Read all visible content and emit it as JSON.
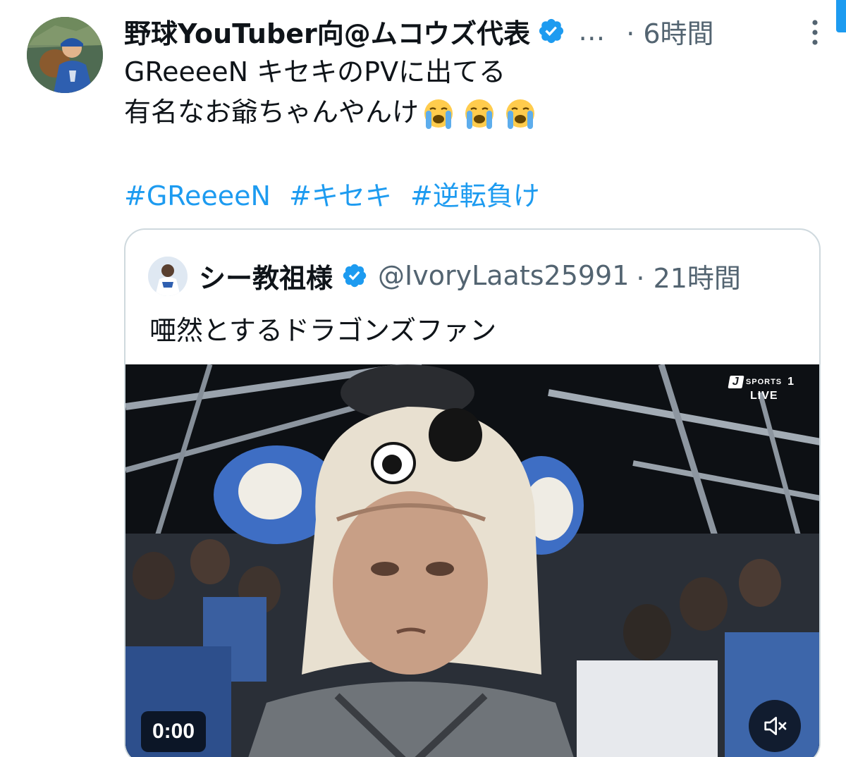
{
  "tweet": {
    "display_name": "野球YouTuber向@ムコウズ代表",
    "truncation": "…",
    "time": "· 6時間",
    "text_lines": [
      "GReeeeN キセキのPVに出てる",
      "有名なお爺ちゃんやんけ"
    ],
    "emoji": [
      "loudly-crying-face",
      "loudly-crying-face",
      "loudly-crying-face"
    ],
    "hashtags": [
      "#GReeeeN",
      "#キセキ",
      "#逆転負け"
    ]
  },
  "quoted": {
    "display_name": "シー教祖様",
    "handle": "@IvoryLaats25991",
    "time": "· 21時間",
    "text": "唖然とするドラゴンズファン",
    "video": {
      "broadcast_brand": "SPORTS",
      "broadcast_channel": "1",
      "broadcast_status": "LIVE",
      "brand_letter": "J",
      "timestamp": "0:00",
      "muted": true
    }
  },
  "colors": {
    "link": "#1d9bf0",
    "verified": "#1d9bf0",
    "secondary_text": "#536471",
    "border": "#cfd9de"
  }
}
